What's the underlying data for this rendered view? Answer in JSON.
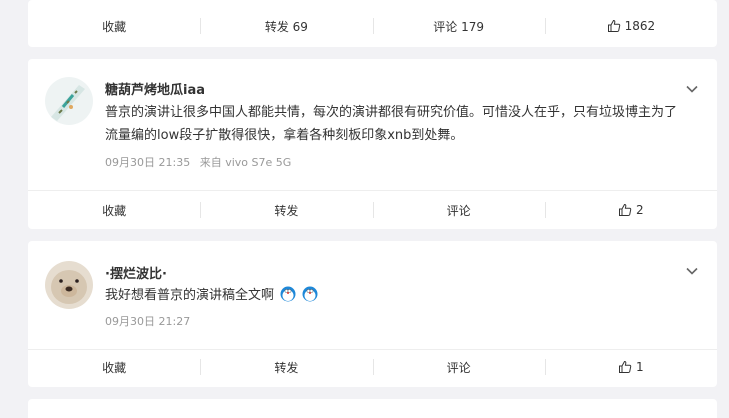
{
  "post_top": {
    "actions": {
      "favorite": "收藏",
      "repost": "转发 69",
      "comment": "评论 179",
      "like": "1862"
    }
  },
  "comment1": {
    "username": "糖葫芦烤地瓜iaa",
    "text": "普京的演讲让很多中国人都能共情，每次的演讲都很有研究价值。可惜没人在乎，只有垃圾博主为了流量编的low段子扩散得很快，拿着各种刻板印象xnb到处舞。",
    "date": "09月30日 21:35",
    "source": "来自 vivo S7e 5G",
    "actions": {
      "favorite": "收藏",
      "repost": "转发",
      "comment": "评论",
      "like": "2"
    }
  },
  "comment2": {
    "username": "·摆烂波比·",
    "text": "我好想看普京的演讲稿全文啊",
    "date": "09月30日 21:27",
    "actions": {
      "favorite": "收藏",
      "repost": "转发",
      "comment": "评论",
      "like": "1"
    }
  }
}
